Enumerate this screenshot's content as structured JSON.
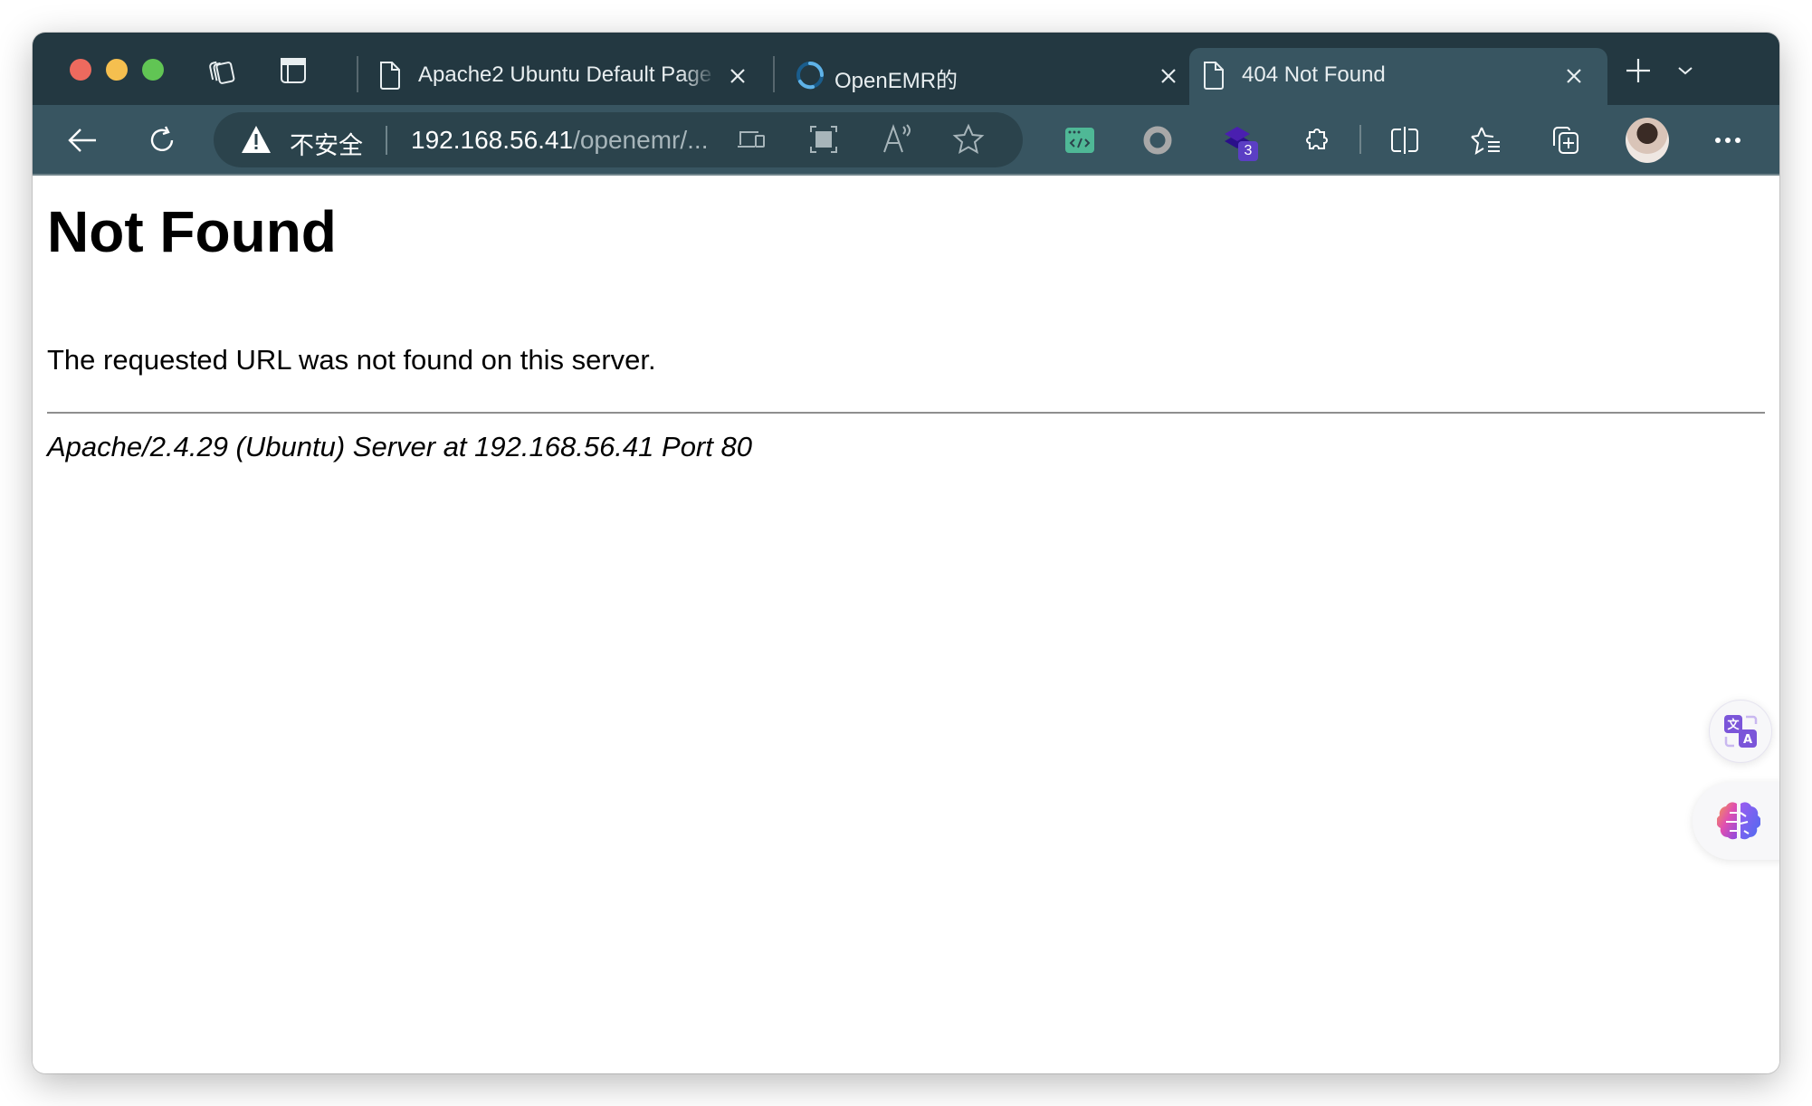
{
  "window": {
    "controls": [
      "close",
      "minimize",
      "zoom"
    ]
  },
  "tabstrip": {
    "left_icons": [
      "workspaces-icon",
      "vertical-tabs-icon"
    ],
    "tabs": [
      {
        "title": "Apache2 Ubuntu Default Page",
        "icon": "page-icon",
        "active": false,
        "close_label": "×"
      },
      {
        "title": "OpenEMR的",
        "icon": "loading-spinner-icon",
        "active": false,
        "close_label": "×"
      },
      {
        "title": "404 Not Found",
        "icon": "page-icon",
        "active": true,
        "close_label": "×"
      }
    ],
    "new_tab_label": "+",
    "tab_list_label": "⌄"
  },
  "toolbar": {
    "security_label": "不安全",
    "url_host": "192.168.56.41",
    "url_path": "/openemr/...",
    "omnibox_icons": [
      "device-icon",
      "apps-icon",
      "read-aloud-icon",
      "favorite-star-icon"
    ],
    "extensions": [
      {
        "name": "code-extension-icon",
        "color": "#4fb896"
      },
      {
        "name": "circle-extension-icon",
        "color": "#a8a8a8"
      },
      {
        "name": "layers-extension-icon",
        "color": "#4a1fb0",
        "badge": "3"
      }
    ],
    "right_icons": [
      "extensions-puzzle-icon",
      "split-screen-icon",
      "favorites-list-icon",
      "collections-icon",
      "profile-avatar",
      "more-menu-icon"
    ],
    "more_label": "···"
  },
  "page": {
    "heading": "Not Found",
    "message": "The requested URL was not found on this server.",
    "server_signature": "Apache/2.4.29 (Ubuntu) Server at 192.168.56.41 Port 80"
  },
  "floating": {
    "translate_button": "translate-icon",
    "ai_button": "ai-brain-icon"
  },
  "colors": {
    "tabstrip_bg": "#233841",
    "toolbar_bg": "#385561",
    "omnibox_bg": "#2b434c",
    "badge_bg": "#5b3fc4"
  }
}
